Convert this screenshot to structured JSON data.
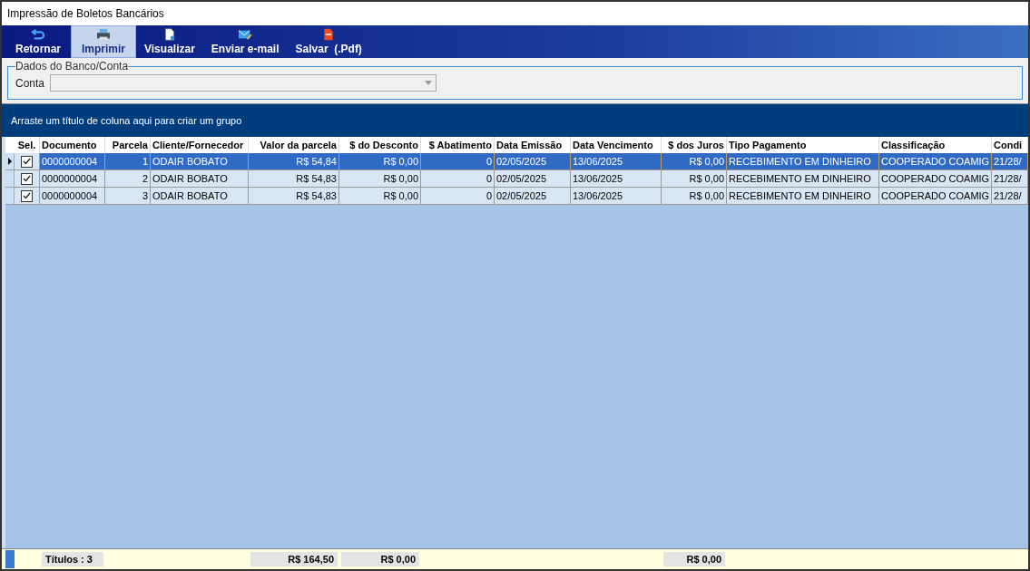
{
  "window": {
    "title": "Impressão de Boletos Bancários"
  },
  "toolbar": [
    {
      "label": "Retornar",
      "selected": false
    },
    {
      "label": "Imprimir",
      "selected": true
    },
    {
      "label": "Visualizar",
      "selected": false
    },
    {
      "label": "Enviar e-mail",
      "selected": false
    },
    {
      "label": "Salvar  (.Pdf)",
      "selected": false
    }
  ],
  "bank_group": {
    "title": "Dados do Banco/Conta",
    "account_label": "Conta"
  },
  "group_panel": {
    "hint": "Arraste um título de coluna aqui para criar um grupo"
  },
  "table": {
    "select_column": "Sel.",
    "columns": [
      "Documento",
      "Parcela",
      "Cliente/Fornecedor",
      "Valor da parcela",
      "$ do Desconto",
      "$ Abatimento",
      "Data Emissão",
      "Data Vencimento",
      "$ dos Juros",
      "Tipo Pagamento",
      "Classificação",
      "Condi"
    ],
    "rows": [
      {
        "selected": true,
        "checked": true,
        "cells": [
          "0000000004",
          "1",
          "ODAIR BOBATO",
          "R$ 54,84",
          "R$ 0,00",
          "0",
          "02/05/2025",
          "13/06/2025",
          "R$ 0,00",
          "RECEBIMENTO EM DINHEIRO",
          "COOPERADO COAMIG",
          "21/28/"
        ]
      },
      {
        "selected": false,
        "checked": true,
        "cells": [
          "0000000004",
          "2",
          "ODAIR BOBATO",
          "R$ 54,83",
          "R$ 0,00",
          "0",
          "02/05/2025",
          "13/06/2025",
          "R$ 0,00",
          "RECEBIMENTO EM DINHEIRO",
          "COOPERADO COAMIG",
          "21/28/"
        ]
      },
      {
        "selected": false,
        "checked": true,
        "cells": [
          "0000000004",
          "3",
          "ODAIR BOBATO",
          "R$ 54,83",
          "R$ 0,00",
          "0",
          "02/05/2025",
          "13/06/2025",
          "R$ 0,00",
          "RECEBIMENTO EM DINHEIRO",
          "COOPERADO COAMIG",
          "21/28/"
        ]
      }
    ],
    "footer": {
      "count": "Títulos : 3",
      "total_value": "R$ 164,50",
      "total_discount": "R$ 0,00",
      "total_interest": "R$ 0,00"
    }
  }
}
